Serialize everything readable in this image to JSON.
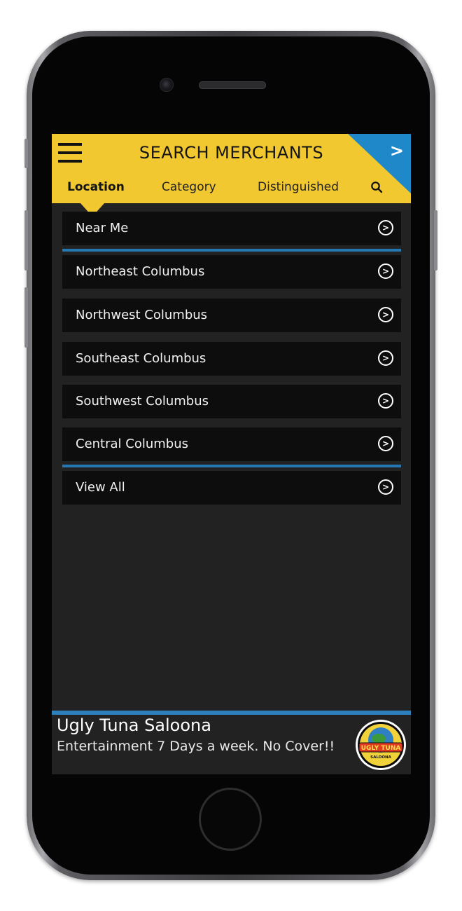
{
  "header": {
    "title": "SEARCH MERCHANTS",
    "corner_arrow": ">",
    "tabs": [
      {
        "label": "Location",
        "active": true
      },
      {
        "label": "Category",
        "active": false
      },
      {
        "label": "Distinguished",
        "active": false
      }
    ]
  },
  "locations": [
    {
      "label": "Near Me"
    },
    {
      "label": "Northeast Columbus"
    },
    {
      "label": "Northwest Columbus"
    },
    {
      "label": "Southeast Columbus"
    },
    {
      "label": "Southwest Columbus"
    },
    {
      "label": "Central Columbus"
    },
    {
      "label": "View All"
    }
  ],
  "go_glyph": ">",
  "ad": {
    "title": "Ugly Tuna Saloona",
    "subtitle": "Entertainment 7 Days a week. No Cover!!",
    "logo_text": "UGLY TUNA",
    "logo_subtext": "SALOONA"
  },
  "colors": {
    "header_yellow": "#f1c82f",
    "accent_blue": "#2378b3",
    "item_bg": "#0d0d0d",
    "screen_bg": "#222222"
  },
  "icons": [
    "menu-icon",
    "search-icon",
    "chevron-right-circle-icon"
  ]
}
